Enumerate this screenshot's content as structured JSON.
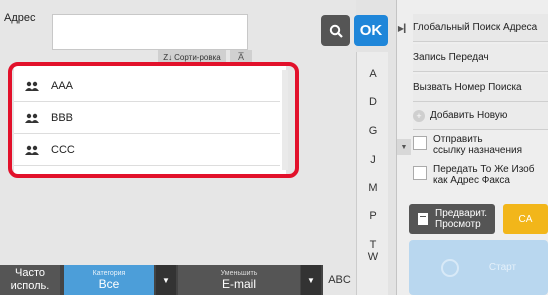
{
  "address": {
    "label": "Адрес",
    "value": ""
  },
  "buttons": {
    "ok": "OK",
    "sort": "Сорти-ровка"
  },
  "list": {
    "items": [
      {
        "label": "AAA"
      },
      {
        "label": "BBB"
      },
      {
        "label": "CCC"
      }
    ]
  },
  "alpha_index": [
    "A",
    "D",
    "G",
    "J",
    "M",
    "P",
    "T",
    "W"
  ],
  "bottom_bar": {
    "often_line1": "Часто",
    "often_line2": "исполь.",
    "category_caption": "Категория",
    "category_value": "Все",
    "reduce_caption": "Уменьшить",
    "reduce_value": "E-mail",
    "abc": "ABC"
  },
  "right_panel": {
    "global_search": "Глобальный Поиск Адреса",
    "send_record": "Запись Передач",
    "call_search_number": "Вызвать Номер Поиска",
    "add_new": "Добавить Новую",
    "send_link_line1": "Отправить",
    "send_link_line2": "ссылку назначения",
    "same_image_line1": "Передать То Же Изоб",
    "same_image_line2": "как Адрес Факса",
    "preview_line1": "Предварит.",
    "preview_line2": "Просмотр",
    "ca": "CA",
    "start": "Старт"
  },
  "colors": {
    "accent": "#1f86d9",
    "highlight": "#e2112b",
    "ca": "#f2b61a",
    "category_tab": "#4c9ed9"
  }
}
